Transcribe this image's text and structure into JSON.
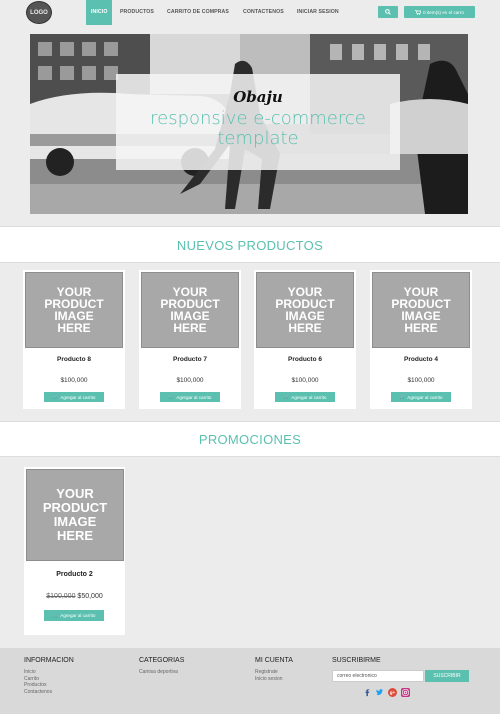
{
  "nav": {
    "logo_text": "LOGO",
    "items": [
      {
        "label": "Inicio",
        "active": true
      },
      {
        "label": "Productos"
      },
      {
        "label": "Carrito de compras"
      },
      {
        "label": "Contactenos"
      },
      {
        "label": "Iniciar sesion"
      }
    ],
    "cart_label": "0 item(s) en el carro",
    "search_icon": "search-icon",
    "cart_icon": "cart-icon"
  },
  "hero": {
    "brand": "Obaju",
    "tagline_line1": "responsive e-commerce",
    "tagline_line2": "template"
  },
  "sections": {
    "new_products": "NUEVOS PRODUCTOS",
    "promotions": "PROMOCIONES"
  },
  "placeholder_text": {
    "line1": "YOUR",
    "line2": "PRODUCT",
    "line3": "IMAGE",
    "line4": "HERE"
  },
  "products": [
    {
      "name": "Producto 8",
      "price": "$100,000",
      "button": "Agregar al carrito"
    },
    {
      "name": "Producto 7",
      "price": "$100,000",
      "button": "Agregar al carrito"
    },
    {
      "name": "Producto 6",
      "price": "$100,000",
      "button": "Agregar al carrito"
    },
    {
      "name": "Producto 4",
      "price": "$100,000",
      "button": "Agregar al carrito"
    }
  ],
  "promotion": {
    "name": "Producto 2",
    "old_price": "$100,000",
    "new_price": "$50,000",
    "button": "Agregar al carrito"
  },
  "footer": {
    "info_title": "INFORMACION",
    "info_links": [
      "Inicio",
      "Carrito",
      "Productos",
      "Contactenos"
    ],
    "cat_title": "CATEGORIAS",
    "cat_links": [
      "Camisa deportiva"
    ],
    "account_title": "MI CUENTA",
    "account_links": [
      "Registrate",
      "Inicio sesion"
    ],
    "sub_title": "SUSCRIBIRME",
    "sub_placeholder": "correo electronico",
    "sub_button": "SUSCRIBIR",
    "social": [
      "facebook-icon",
      "twitter-icon",
      "google-plus-icon",
      "instagram-icon"
    ]
  },
  "colors": {
    "accent": "#5bc0b0",
    "background": "#ececec",
    "footer": "#d9d9d9"
  }
}
